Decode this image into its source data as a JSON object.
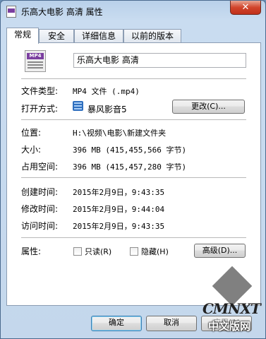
{
  "window": {
    "title": "乐高大电影 高清 属性",
    "close_label": "✕"
  },
  "tabs": [
    {
      "label": "常规",
      "active": true
    },
    {
      "label": "安全",
      "active": false
    },
    {
      "label": "详细信息",
      "active": false
    },
    {
      "label": "以前的版本",
      "active": false
    }
  ],
  "file": {
    "icon_text": "MP4",
    "name": "乐高大电影 高清"
  },
  "props": {
    "type_label": "文件类型:",
    "type_value": "MP4 文件 (.mp4)",
    "open_label": "打开方式:",
    "open_value": "暴风影音5",
    "change_button": "更改(C)...",
    "location_label": "位置:",
    "location_value": "H:\\视频\\电影\\新建文件夹",
    "size_label": "大小:",
    "size_value": "396 MB (415,455,566 字节)",
    "disk_label": "占用空间:",
    "disk_value": "396 MB (415,457,280 字节)",
    "created_label": "创建时间:",
    "created_value": "2015年2月9日，9:43:35",
    "modified_label": "修改时间:",
    "modified_value": "2015年2月9日，9:44:04",
    "accessed_label": "访问时间:",
    "accessed_value": "2015年2月9日，9:43:35",
    "attr_label": "属性:",
    "readonly_label": "只读(R)",
    "hidden_label": "隐藏(H)",
    "advanced_button": "高级(D)..."
  },
  "footer": {
    "ok": "确定",
    "cancel": "取消",
    "apply": "应用(A)"
  },
  "watermark": {
    "text": "CMNXT",
    "sub": "中文版网"
  }
}
